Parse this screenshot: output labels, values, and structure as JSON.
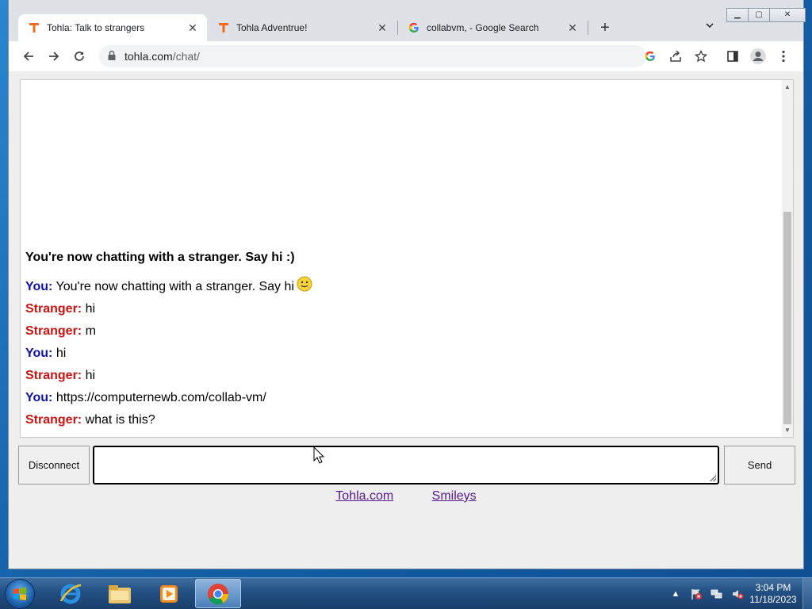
{
  "browser": {
    "tabs": [
      {
        "title": "Tohla: Talk to strangers",
        "favicon": "tohla-t-icon",
        "active": true
      },
      {
        "title": "Tohla Adventrue!",
        "favicon": "tohla-t-icon",
        "active": false
      },
      {
        "title": "collabvm, - Google Search",
        "favicon": "google-g-icon",
        "active": false
      }
    ],
    "url_domain": "tohla.com",
    "url_path": "/chat/"
  },
  "chat": {
    "status": "You're now chatting with a stranger. Say hi :)",
    "messages": [
      {
        "sender": "You:",
        "role": "you",
        "text": "You're now chatting with a stranger. Say hi",
        "smiley": true
      },
      {
        "sender": "Stranger:",
        "role": "stranger",
        "text": "hi"
      },
      {
        "sender": "Stranger:",
        "role": "stranger",
        "text": "m"
      },
      {
        "sender": "You:",
        "role": "you",
        "text": "hi"
      },
      {
        "sender": "Stranger:",
        "role": "stranger",
        "text": "hi"
      },
      {
        "sender": "You:",
        "role": "you",
        "text": "https://computernewb.com/collab-vm/"
      },
      {
        "sender": "Stranger:",
        "role": "stranger",
        "text": "what is this?"
      }
    ],
    "disconnect_label": "Disconnect",
    "send_label": "Send",
    "input_value": ""
  },
  "footer": {
    "links": [
      "Tohla.com",
      "Smileys"
    ]
  },
  "taskbar": {
    "time": "3:04 PM",
    "date": "11/18/2023"
  },
  "colors": {
    "you": "#1111aa",
    "stranger": "#cc1111",
    "tohla_orange": "#f26a1b"
  }
}
